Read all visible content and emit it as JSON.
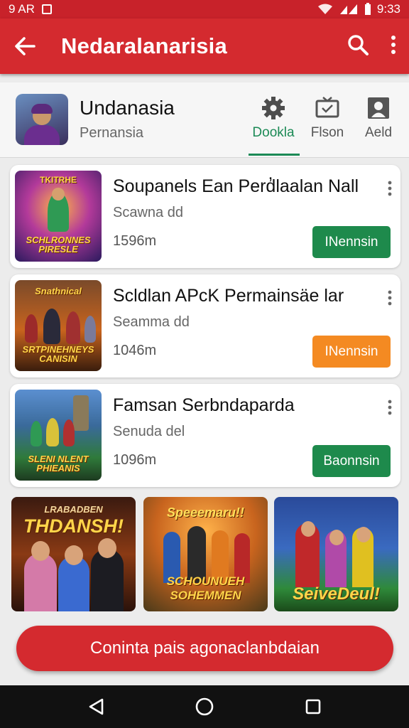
{
  "status_bar": {
    "time_left": "9 AR",
    "clock": "9:33"
  },
  "app_bar": {
    "title": "Nedaralanarisia"
  },
  "profile": {
    "name": "Undanasia",
    "subtitle": "Pernansia",
    "tabs": [
      {
        "label": "Dookla",
        "icon": "gear-icon",
        "active": true
      },
      {
        "label": "Flson",
        "icon": "tv-icon",
        "active": false
      },
      {
        "label": "Aeld",
        "icon": "person-icon",
        "active": false
      }
    ]
  },
  "games": [
    {
      "title": "Soupanels Ean Perd̓laalan Nall",
      "subtitle": "Scawna dd",
      "size": "1596m",
      "button": "INennsin",
      "button_color": "#1e8a4c",
      "thumb_caption": "SCHLRONNES PIRESLE",
      "thumb_top": "TKITRHE"
    },
    {
      "title": "Scldlan APcK Permainsäe lar",
      "subtitle": "Seamma dd",
      "size": "1046m",
      "button": "INennsin",
      "button_color": "#f48a22",
      "thumb_caption": "SRTPINEHNEYS CANISIN",
      "thumb_top": "Snathnical"
    },
    {
      "title": "Famsan Serbndaparda",
      "subtitle": "Senuda del",
      "size": "1096m",
      "button": "Baonnsin",
      "button_color": "#1e8a4c",
      "thumb_caption": "SLENI NLENT PHIEANIS",
      "thumb_top": ""
    }
  ],
  "banners": [
    {
      "top_text": "LRABADBEN",
      "title": "THDANSH!"
    },
    {
      "top_text": "Speeemaru!!",
      "title": "SCHOUNUEH SOHEMMEN"
    },
    {
      "top_text": "",
      "title": "SeiveDeul!"
    }
  ],
  "cta": {
    "label": "Coninta pais agonaclanbdaian"
  },
  "colors": {
    "primary_red": "#d42a2f",
    "green": "#1e8a4c",
    "orange": "#f48a22"
  }
}
